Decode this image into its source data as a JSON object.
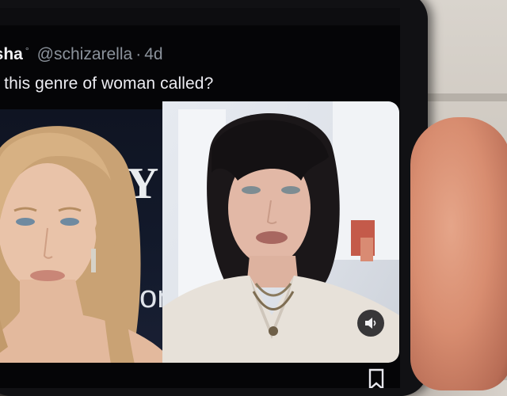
{
  "tweet": {
    "display_name": "nisha",
    "verified_mark": "°",
    "handle": "@schizarella",
    "separator": "·",
    "age": "4d",
    "text": "t is this genre of woman called?"
  },
  "media": {
    "left_image": "portrait-blonde-woman",
    "left_backdrop_text_1": "IY",
    "left_backdrop_text_2": "on",
    "right_image": "portrait-dark-haired-woman",
    "mute_icon": "speaker-mute-icon"
  },
  "toolbar": {
    "bookmark_icon": "bookmark-icon"
  },
  "colors": {
    "background": "#050507",
    "text_primary": "#ececf1",
    "text_secondary": "#8b929b"
  }
}
